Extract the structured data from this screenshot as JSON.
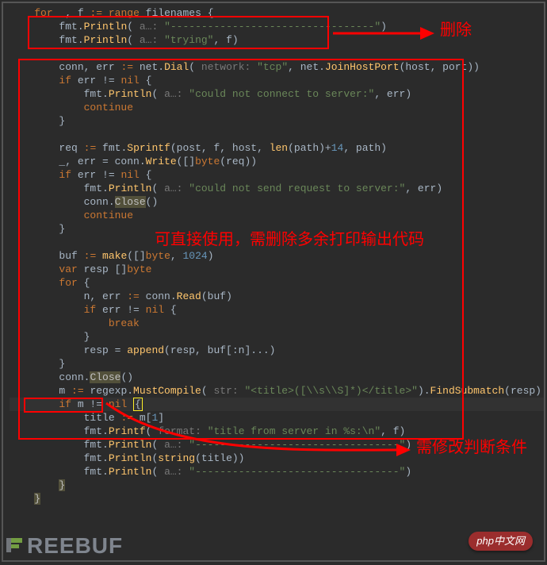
{
  "code": {
    "lines": [
      {
        "indent": 1,
        "tokens": [
          {
            "cls": "kw",
            "t": "for"
          },
          {
            "cls": "id",
            "t": " _"
          },
          {
            "cls": "id",
            "t": ", f "
          },
          {
            "cls": "kw",
            "t": ":= "
          },
          {
            "cls": "kw",
            "t": "range"
          },
          {
            "cls": "id",
            "t": " filenames {"
          }
        ]
      },
      {
        "indent": 2,
        "tokens": [
          {
            "cls": "id",
            "t": "fmt."
          },
          {
            "cls": "fn",
            "t": "Println"
          },
          {
            "cls": "id",
            "t": "( "
          },
          {
            "cls": "hint",
            "t": "a…: "
          },
          {
            "cls": "str",
            "t": "\"---------------------------------\""
          },
          {
            "cls": "id",
            "t": ")"
          }
        ]
      },
      {
        "indent": 2,
        "tokens": [
          {
            "cls": "id",
            "t": "fmt."
          },
          {
            "cls": "fn",
            "t": "Println"
          },
          {
            "cls": "id",
            "t": "( "
          },
          {
            "cls": "hint",
            "t": "a…: "
          },
          {
            "cls": "str",
            "t": "\"trying\""
          },
          {
            "cls": "id",
            "t": ", f)"
          }
        ]
      },
      {
        "indent": 0,
        "tokens": []
      },
      {
        "indent": 2,
        "tokens": [
          {
            "cls": "id",
            "t": "conn, err "
          },
          {
            "cls": "kw",
            "t": ":= "
          },
          {
            "cls": "id",
            "t": "net."
          },
          {
            "cls": "fn",
            "t": "Dial"
          },
          {
            "cls": "id",
            "t": "( "
          },
          {
            "cls": "hint",
            "t": "network: "
          },
          {
            "cls": "str",
            "t": "\"tcp\""
          },
          {
            "cls": "id",
            "t": ", net."
          },
          {
            "cls": "fn",
            "t": "JoinHostPort"
          },
          {
            "cls": "id",
            "t": "(host, port))"
          }
        ]
      },
      {
        "indent": 2,
        "tokens": [
          {
            "cls": "kw",
            "t": "if"
          },
          {
            "cls": "id",
            "t": " err != "
          },
          {
            "cls": "kw",
            "t": "nil"
          },
          {
            "cls": "id",
            "t": " {"
          }
        ]
      },
      {
        "indent": 3,
        "tokens": [
          {
            "cls": "id",
            "t": "fmt."
          },
          {
            "cls": "fn",
            "t": "Println"
          },
          {
            "cls": "id",
            "t": "( "
          },
          {
            "cls": "hint",
            "t": "a…: "
          },
          {
            "cls": "str",
            "t": "\"could not connect to server:\""
          },
          {
            "cls": "id",
            "t": ", err)"
          }
        ]
      },
      {
        "indent": 3,
        "tokens": [
          {
            "cls": "kw",
            "t": "continue"
          }
        ]
      },
      {
        "indent": 2,
        "tokens": [
          {
            "cls": "id",
            "t": "}"
          }
        ]
      },
      {
        "indent": 0,
        "tokens": []
      },
      {
        "indent": 2,
        "tokens": [
          {
            "cls": "id",
            "t": "req "
          },
          {
            "cls": "kw",
            "t": ":= "
          },
          {
            "cls": "id",
            "t": "fmt."
          },
          {
            "cls": "fn",
            "t": "Sprintf"
          },
          {
            "cls": "id",
            "t": "(post, f, host, "
          },
          {
            "cls": "fn",
            "t": "len"
          },
          {
            "cls": "id",
            "t": "(path)+"
          },
          {
            "cls": "num",
            "t": "14"
          },
          {
            "cls": "id",
            "t": ", path)"
          }
        ]
      },
      {
        "indent": 2,
        "tokens": [
          {
            "cls": "id",
            "t": "_, err = conn."
          },
          {
            "cls": "fn",
            "t": "Write"
          },
          {
            "cls": "id",
            "t": "([]"
          },
          {
            "cls": "kw",
            "t": "byte"
          },
          {
            "cls": "id",
            "t": "(req))"
          }
        ]
      },
      {
        "indent": 2,
        "tokens": [
          {
            "cls": "kw",
            "t": "if"
          },
          {
            "cls": "id",
            "t": " err != "
          },
          {
            "cls": "kw",
            "t": "nil"
          },
          {
            "cls": "id",
            "t": " {"
          }
        ]
      },
      {
        "indent": 3,
        "tokens": [
          {
            "cls": "id",
            "t": "fmt."
          },
          {
            "cls": "fn",
            "t": "Println"
          },
          {
            "cls": "id",
            "t": "( "
          },
          {
            "cls": "hint",
            "t": "a…: "
          },
          {
            "cls": "str",
            "t": "\"could not send request to server:\""
          },
          {
            "cls": "id",
            "t": ", err)"
          }
        ]
      },
      {
        "indent": 3,
        "tokens": [
          {
            "cls": "id",
            "t": "conn."
          },
          {
            "cls": "dim",
            "t": "Close"
          },
          {
            "cls": "id",
            "t": "()"
          }
        ]
      },
      {
        "indent": 3,
        "tokens": [
          {
            "cls": "kw",
            "t": "continue"
          }
        ]
      },
      {
        "indent": 2,
        "tokens": [
          {
            "cls": "id",
            "t": "}"
          }
        ]
      },
      {
        "indent": 0,
        "tokens": []
      },
      {
        "indent": 2,
        "tokens": [
          {
            "cls": "id",
            "t": "buf "
          },
          {
            "cls": "kw",
            "t": ":= "
          },
          {
            "cls": "fn",
            "t": "make"
          },
          {
            "cls": "id",
            "t": "([]"
          },
          {
            "cls": "kw",
            "t": "byte"
          },
          {
            "cls": "id",
            "t": ", "
          },
          {
            "cls": "num",
            "t": "1024"
          },
          {
            "cls": "id",
            "t": ")"
          }
        ]
      },
      {
        "indent": 2,
        "tokens": [
          {
            "cls": "kw",
            "t": "var"
          },
          {
            "cls": "id",
            "t": " resp []"
          },
          {
            "cls": "kw",
            "t": "byte"
          }
        ]
      },
      {
        "indent": 2,
        "tokens": [
          {
            "cls": "kw",
            "t": "for"
          },
          {
            "cls": "id",
            "t": " {"
          }
        ]
      },
      {
        "indent": 3,
        "tokens": [
          {
            "cls": "id",
            "t": "n, err "
          },
          {
            "cls": "kw",
            "t": ":= "
          },
          {
            "cls": "id",
            "t": "conn."
          },
          {
            "cls": "fn",
            "t": "Read"
          },
          {
            "cls": "id",
            "t": "(buf)"
          }
        ]
      },
      {
        "indent": 3,
        "tokens": [
          {
            "cls": "kw",
            "t": "if"
          },
          {
            "cls": "id",
            "t": " err != "
          },
          {
            "cls": "kw",
            "t": "nil"
          },
          {
            "cls": "id",
            "t": " {"
          }
        ]
      },
      {
        "indent": 4,
        "tokens": [
          {
            "cls": "kw",
            "t": "break"
          }
        ]
      },
      {
        "indent": 3,
        "tokens": [
          {
            "cls": "id",
            "t": "}"
          }
        ]
      },
      {
        "indent": 3,
        "tokens": [
          {
            "cls": "id",
            "t": "resp = "
          },
          {
            "cls": "fn",
            "t": "append"
          },
          {
            "cls": "id",
            "t": "(resp, buf[:n]...)"
          }
        ]
      },
      {
        "indent": 2,
        "tokens": [
          {
            "cls": "id",
            "t": "}"
          }
        ]
      },
      {
        "indent": 2,
        "tokens": [
          {
            "cls": "id",
            "t": "conn."
          },
          {
            "cls": "dim",
            "t": "Close"
          },
          {
            "cls": "id",
            "t": "()"
          }
        ]
      },
      {
        "indent": 2,
        "tokens": [
          {
            "cls": "id",
            "t": "m "
          },
          {
            "cls": "kw",
            "t": ":= "
          },
          {
            "cls": "id",
            "t": "regexp."
          },
          {
            "cls": "fn",
            "t": "MustCompile"
          },
          {
            "cls": "id",
            "t": "( "
          },
          {
            "cls": "hint",
            "t": "str: "
          },
          {
            "cls": "str",
            "t": "\"<title>([\\\\s\\\\S]*)</title>\""
          },
          {
            "cls": "id",
            "t": ")."
          },
          {
            "cls": "fn",
            "t": "FindSubmatch"
          },
          {
            "cls": "id",
            "t": "(resp)"
          }
        ]
      },
      {
        "indent": 2,
        "hl": true,
        "tokens": [
          {
            "cls": "kw",
            "t": "if"
          },
          {
            "cls": "id",
            "t": " m != "
          },
          {
            "cls": "kw",
            "t": "nil"
          },
          {
            "cls": "id",
            "t": " "
          },
          {
            "cls": "caret-bracket",
            "t": "{"
          }
        ]
      },
      {
        "indent": 3,
        "tokens": [
          {
            "cls": "id",
            "t": "title "
          },
          {
            "cls": "kw",
            "t": ":= "
          },
          {
            "cls": "id",
            "t": "m["
          },
          {
            "cls": "num",
            "t": "1"
          },
          {
            "cls": "id",
            "t": "]"
          }
        ]
      },
      {
        "indent": 3,
        "tokens": [
          {
            "cls": "id",
            "t": "fmt."
          },
          {
            "cls": "fn",
            "t": "Printf"
          },
          {
            "cls": "id",
            "t": "( "
          },
          {
            "cls": "hint",
            "t": "format: "
          },
          {
            "cls": "str",
            "t": "\"title from server in %s:\\n\""
          },
          {
            "cls": "id",
            "t": ", f)"
          }
        ]
      },
      {
        "indent": 3,
        "tokens": [
          {
            "cls": "id",
            "t": "fmt."
          },
          {
            "cls": "fn",
            "t": "Println"
          },
          {
            "cls": "id",
            "t": "( "
          },
          {
            "cls": "hint",
            "t": "a…: "
          },
          {
            "cls": "str",
            "t": "\"---------------------------------\""
          },
          {
            "cls": "id",
            "t": ")"
          }
        ]
      },
      {
        "indent": 3,
        "tokens": [
          {
            "cls": "id",
            "t": "fmt."
          },
          {
            "cls": "fn",
            "t": "Println"
          },
          {
            "cls": "id",
            "t": "("
          },
          {
            "cls": "fn",
            "t": "string"
          },
          {
            "cls": "id",
            "t": "(title))"
          }
        ]
      },
      {
        "indent": 3,
        "tokens": [
          {
            "cls": "id",
            "t": "fmt."
          },
          {
            "cls": "fn",
            "t": "Println"
          },
          {
            "cls": "id",
            "t": "( "
          },
          {
            "cls": "hint",
            "t": "a…: "
          },
          {
            "cls": "str",
            "t": "\"---------------------------------\""
          },
          {
            "cls": "id",
            "t": ")"
          }
        ]
      },
      {
        "indent": 2,
        "tokens": [
          {
            "cls": "dim",
            "t": "}"
          }
        ]
      },
      {
        "indent": 1,
        "tokens": [
          {
            "cls": "dim",
            "t": "}"
          }
        ]
      }
    ]
  },
  "annotations": {
    "delete_label": "删除",
    "usable_label": "可直接使用，需删除多余打印输出代码",
    "condition_label": "需修改判断条件"
  },
  "watermark": {
    "text_prefix": "F",
    "text_rest": "REEBUF"
  },
  "badge": {
    "text": "php中文网"
  }
}
